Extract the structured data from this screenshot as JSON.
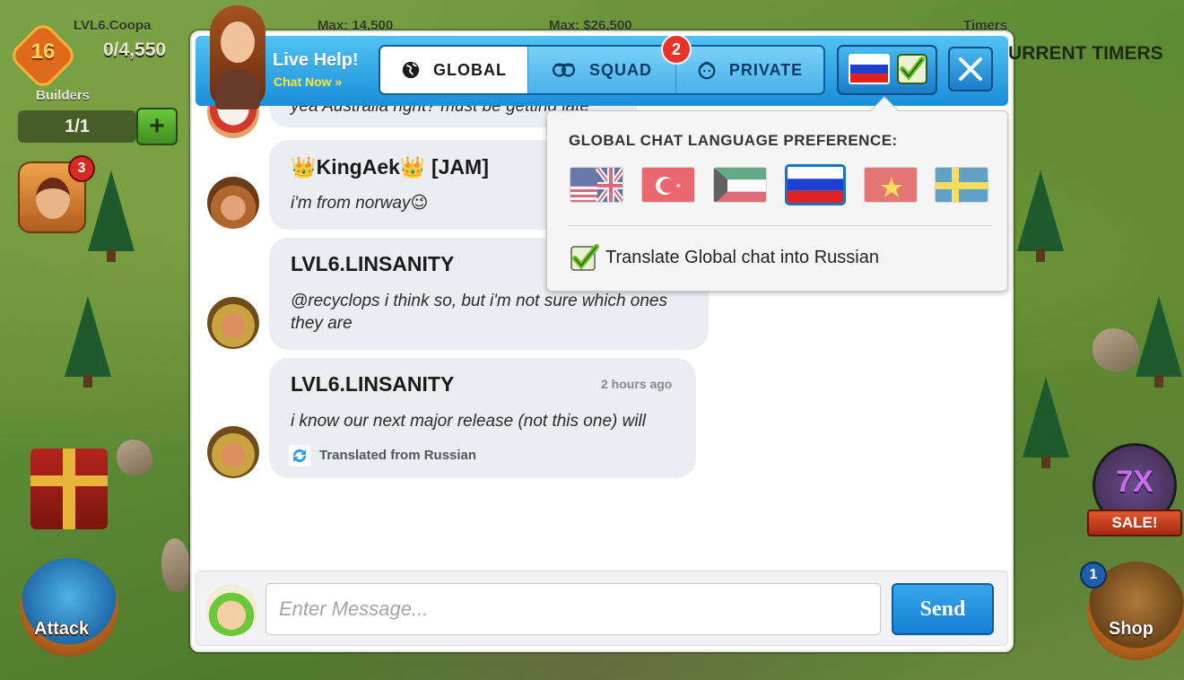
{
  "hud": {
    "player_name": "LVL6.Coopa",
    "xp": "0/4,550",
    "level": "16",
    "max_left": "Max: 14,500",
    "max_right": "Max: $26,500",
    "timers_label": "Timers",
    "current_timers": "URRENT TIMERS",
    "builders_label": "Builders",
    "builders_value": "1/1",
    "builders_plus": "+",
    "hero_badge": "3",
    "attack_label": "Attack",
    "sale_multiplier": "7X",
    "sale_label": "SALE!",
    "shop_badge": "1",
    "shop_label": "Shop"
  },
  "header": {
    "live_help_title": "Live Help!",
    "chat_now": "Chat Now »",
    "tabs": [
      {
        "label": "GLOBAL",
        "icon": "globe-icon",
        "active": true
      },
      {
        "label": "SQUAD",
        "icon": "squad-icon",
        "active": false
      },
      {
        "label": "PRIVATE",
        "icon": "private-icon",
        "active": false
      }
    ],
    "squad_badge": "2",
    "selected_language_flag": "russia-flag"
  },
  "messages": [
    {
      "text": "yea Australia right? must be getting late"
    },
    {
      "name_prefix": "👑KingAek👑",
      "name_suffix": "[JAM]",
      "text": "i'm from norway😉"
    },
    {
      "name": "LVL6.LINSANITY",
      "text": "@recyclops i think so, but i'm not sure which ones they are"
    },
    {
      "name": "LVL6.LINSANITY",
      "time": "2 hours ago",
      "text": "i know our next major release (not this one) will",
      "translated_note": "Translated from Russian"
    }
  ],
  "language_popup": {
    "title": "GLOBAL CHAT LANGUAGE PREFERENCE:",
    "flags": [
      "usa-uk-flag",
      "turkey-flag",
      "kuwait-flag",
      "russia-flag",
      "vietnam-flag",
      "sweden-flag"
    ],
    "selected": "russia-flag",
    "translate_label": "Translate Global chat into Russian",
    "translate_checked": true
  },
  "input": {
    "placeholder": "Enter Message...",
    "value": "",
    "send_label": "Send"
  },
  "colors": {
    "header_blue": "#1a8ed9",
    "tab_active": "#ffffff",
    "badge_red": "#e8332b",
    "send_blue": "#1580d2",
    "bubble": "#ecedf3"
  }
}
